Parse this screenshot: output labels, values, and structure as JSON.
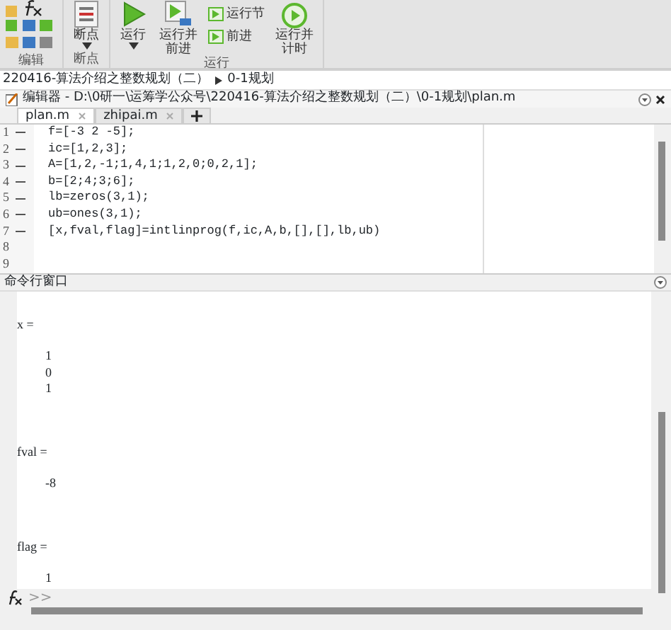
{
  "toolbar": {
    "groups": [
      {
        "label": "编辑",
        "kind": "icons"
      },
      {
        "label": "断点",
        "kind": "buttons",
        "buttons": [
          {
            "kind": "breakpoint",
            "label": "断点",
            "caret": true
          }
        ]
      },
      {
        "label": "运行",
        "kind": "buttons",
        "buttons": [
          {
            "kind": "run",
            "label": "运行",
            "caret": true
          },
          {
            "kind": "run-advance",
            "label": "运行并前进",
            "caret": false
          },
          {
            "kind": "stack",
            "items": [
              {
                "label": "运行节"
              },
              {
                "label": "前进"
              }
            ]
          },
          {
            "kind": "timer",
            "label": "运行并计时",
            "caret": false
          }
        ]
      }
    ]
  },
  "breadcrumb": [
    "220416-算法介绍之整数规划（二）",
    "0-1规划"
  ],
  "editor": {
    "title": "编辑器 - D:\\0研一\\运筹学公众号\\220416-算法介绍之整数规划（二）\\0-1规划\\plan.m",
    "tabs": [
      {
        "label": "plan.m",
        "selected": true
      },
      {
        "label": "zhipai.m",
        "selected": false
      }
    ],
    "lines": [
      {
        "number": "1",
        "executable": true,
        "code": "f=[-3 2 -5];"
      },
      {
        "number": "2",
        "executable": true,
        "code": "ic=[1,2,3];"
      },
      {
        "number": "3",
        "executable": true,
        "code": "A=[1,2,-1;1,4,1;1,2,0;0,2,1];"
      },
      {
        "number": "4",
        "executable": true,
        "code": "b=[2;4;3;6];"
      },
      {
        "number": "5",
        "executable": true,
        "code": "lb=zeros(3,1);"
      },
      {
        "number": "6",
        "executable": true,
        "code": "ub=ones(3,1);"
      },
      {
        "number": "7",
        "executable": true,
        "code": "[x,fval,flag]=intlinprog(f,ic,A,b,[],[],lb,ub)"
      },
      {
        "number": "8",
        "executable": false
      },
      {
        "number": "9",
        "executable": false
      }
    ]
  },
  "command_window": {
    "title": "命令行窗口",
    "outputs": [
      {
        "name": "x =",
        "values": [
          "1",
          "0",
          "1"
        ]
      },
      {
        "name": "fval =",
        "values": [
          "-8"
        ]
      },
      {
        "name": "flag =",
        "values": [
          "1"
        ]
      }
    ],
    "prompt": ">>"
  }
}
